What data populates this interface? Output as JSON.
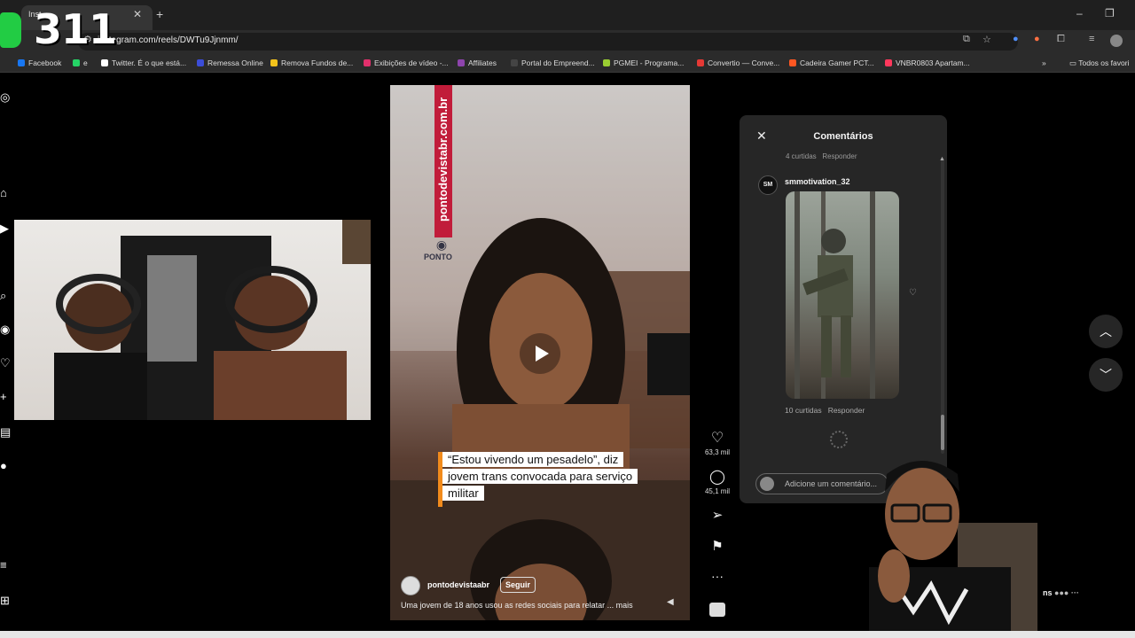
{
  "overlay": {
    "counter": "311"
  },
  "browser": {
    "tab_title": "Inst",
    "url": "instagram.com/reels/DWTu9Jjnmm/",
    "bookmarks": [
      {
        "label": "Facebook",
        "color": "#1877f2"
      },
      {
        "label": "e",
        "color": "#25d366"
      },
      {
        "label": "Twitter. É o que está...",
        "color": "#ffffff"
      },
      {
        "label": "Remessa Online",
        "color": "#3b4dd8"
      },
      {
        "label": "Remova Fundos de...",
        "color": "#f2c21b"
      },
      {
        "label": "Exibições de vídeo -...",
        "color": "#e1306c"
      },
      {
        "label": "Affiliates",
        "color": "#8e44ad"
      },
      {
        "label": "Portal do Empreend...",
        "color": "#444444"
      },
      {
        "label": "PGMEI - Programa...",
        "color": "#9acd32"
      },
      {
        "label": "Convertio — Conve...",
        "color": "#e53935"
      },
      {
        "label": "Cadeira Gamer PCT...",
        "color": "#ff5722"
      },
      {
        "label": "VNBR0803 Apartam...",
        "color": "#ff385c"
      }
    ],
    "bookmarks_more": "»",
    "all_favorites": "Todos os favori"
  },
  "reel": {
    "watermark": "pontodevistabr.com.br",
    "logo_text": "PONTO",
    "caption_lines": [
      "“Estou vivendo um pesadelo”, diz",
      "jovem trans convocada para serviço",
      "militar"
    ],
    "author": "pontodevistaabr",
    "follow_label": "Seguir",
    "description": "Uma jovem de 18 anos usou as redes sociais para relatar ...",
    "more_label": "mais"
  },
  "actions": {
    "likes": "63,3 mil",
    "comments": "45,1 mil"
  },
  "comments_panel": {
    "title": "Comentários",
    "prev_likes": "4 curtidas",
    "prev_reply": "Responder",
    "user": "smmotivation_32",
    "avatar_initials": "SM",
    "likes": "10 curtidas",
    "reply": "Responder",
    "input_placeholder": "Adicione um comentário..."
  },
  "side_messages": "ns"
}
